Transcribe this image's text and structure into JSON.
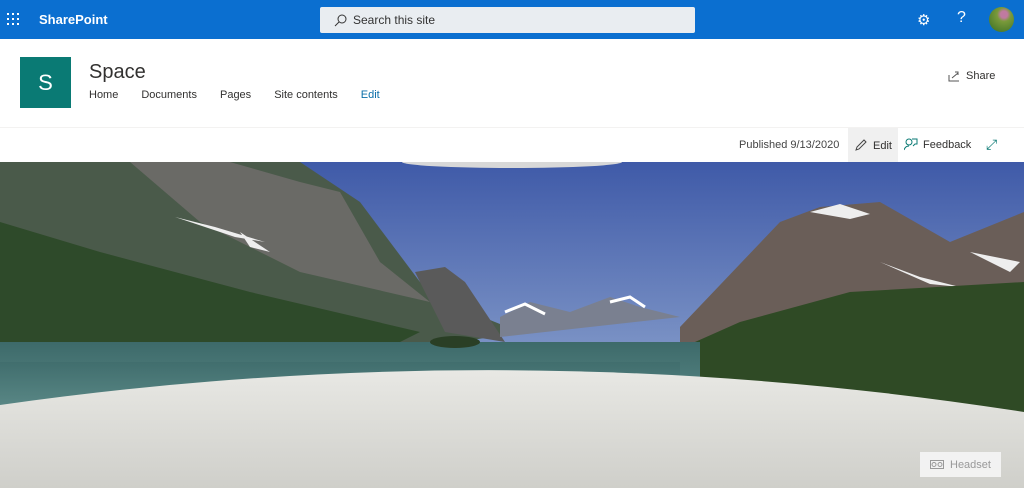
{
  "suitebar": {
    "app_name": "SharePoint",
    "search_placeholder": "Search this site",
    "icons": [
      "waffle-icon",
      "search-icon",
      "gear-icon",
      "help-icon",
      "avatar"
    ]
  },
  "site": {
    "logo_letter": "S",
    "title": "Space",
    "nav": [
      "Home",
      "Documents",
      "Pages",
      "Site contents",
      "Edit"
    ],
    "share_label": "Share"
  },
  "commandbar": {
    "published": "Published 9/13/2020",
    "edit_label": "Edit",
    "feedback_label": "Feedback"
  },
  "viewer": {
    "headset_label": "Headset"
  },
  "colors": {
    "suitebar": "#0b6fd0",
    "logo": "#0a7a74"
  }
}
